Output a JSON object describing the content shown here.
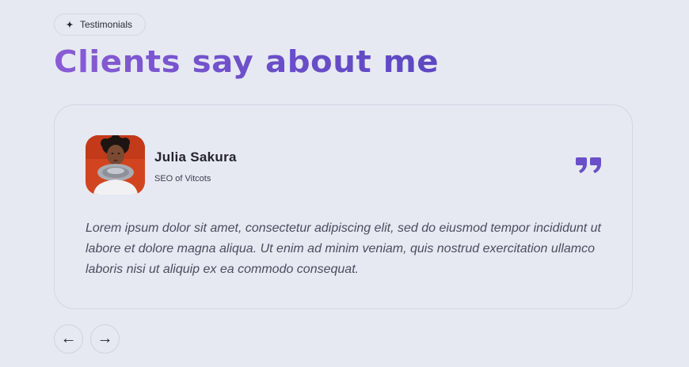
{
  "section": {
    "badge_label": "Testimonials",
    "badge_icon": "sparkle-icon",
    "title": "Clients say about me"
  },
  "testimonial": {
    "name": "Julia Sakura",
    "role": "SEO of Vitcots",
    "quote_icon": "quote-icon",
    "quote": "Lorem ipsum dolor sit amet, consectetur adipiscing elit, sed do eiusmod tempor incididunt ut labore et dolore magna aliqua. Ut enim ad minim veniam, quis nostrud exercitation ullamco laboris nisi ut aliquip ex ea commodo consequat."
  },
  "navigation": {
    "prev_label": "←",
    "next_label": "→"
  },
  "colors": {
    "background": "#e6e9f2",
    "accent": "#7550cc",
    "text_dark": "#23242e",
    "border": "#d3d7e4"
  }
}
